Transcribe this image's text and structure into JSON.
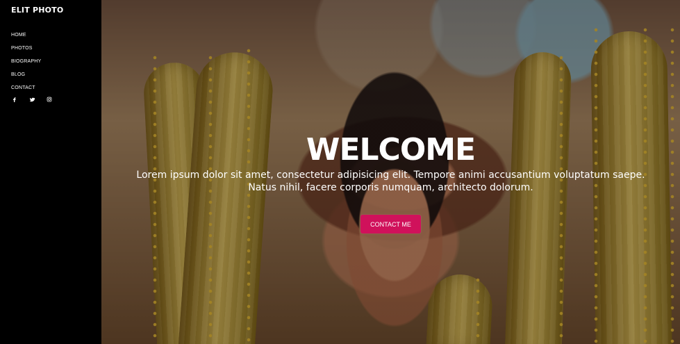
{
  "sidebar": {
    "brand": "ELIT PHOTO",
    "menu": [
      {
        "label": "HOME"
      },
      {
        "label": "PHOTOS"
      },
      {
        "label": "BIOGRAPHY"
      },
      {
        "label": "BLOG"
      },
      {
        "label": "CONTACT"
      }
    ],
    "social": [
      {
        "icon": "facebook-icon"
      },
      {
        "icon": "twitter-icon"
      },
      {
        "icon": "instagram-icon"
      }
    ]
  },
  "hero": {
    "title": "WELCOME",
    "description": "Lorem ipsum dolor sit amet, consectetur adipisicing elit. Tempore animi accusantium voluptatum saepe.\nNatus nihil, facere corporis numquam, architecto dolorum.",
    "cta_label": "CONTACT ME"
  },
  "colors": {
    "sidebar_bg": "#000000",
    "text": "#FFFFFF",
    "accent": "#D0115B"
  }
}
